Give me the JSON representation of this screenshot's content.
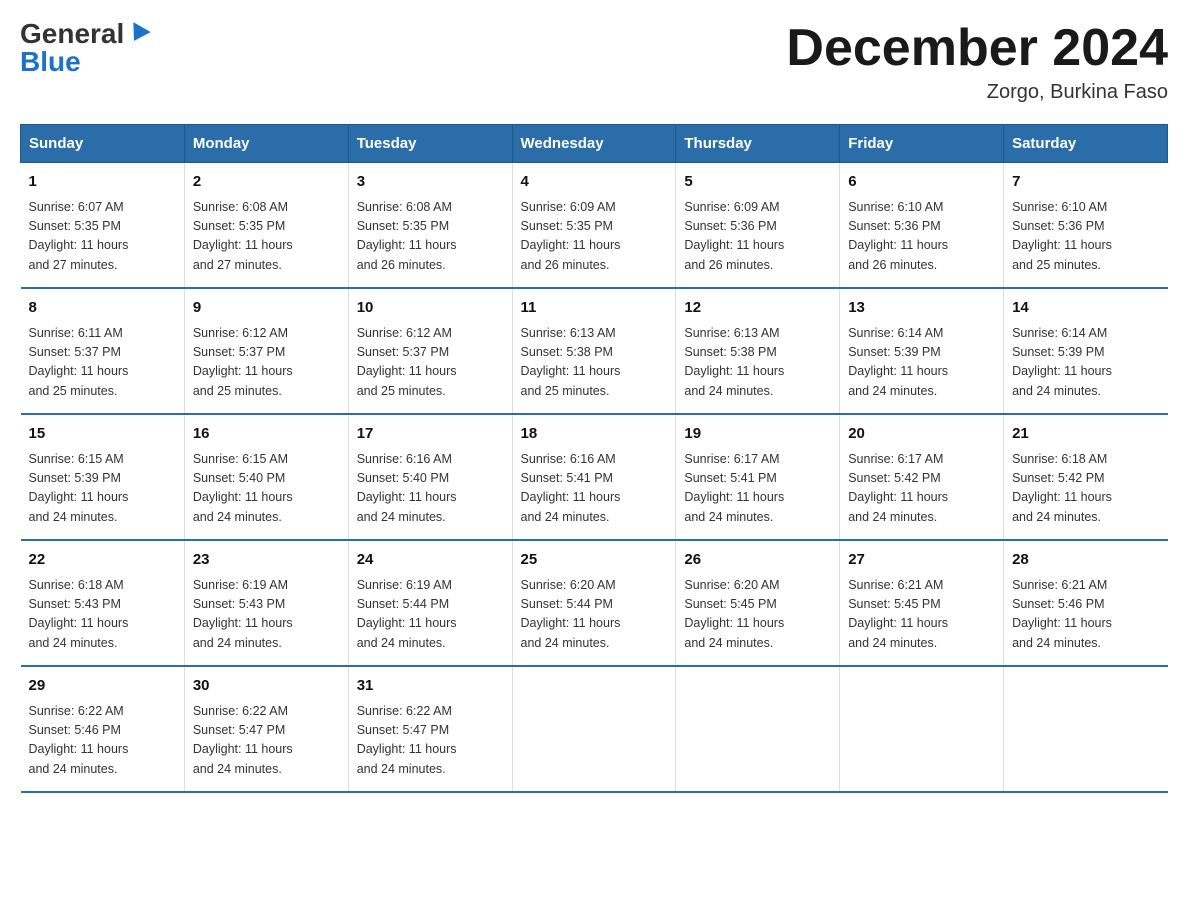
{
  "logo": {
    "general": "General",
    "blue": "Blue"
  },
  "title": "December 2024",
  "location": "Zorgo, Burkina Faso",
  "headers": [
    "Sunday",
    "Monday",
    "Tuesday",
    "Wednesday",
    "Thursday",
    "Friday",
    "Saturday"
  ],
  "weeks": [
    [
      {
        "day": "1",
        "sunrise": "6:07 AM",
        "sunset": "5:35 PM",
        "daylight": "11 hours and 27 minutes."
      },
      {
        "day": "2",
        "sunrise": "6:08 AM",
        "sunset": "5:35 PM",
        "daylight": "11 hours and 27 minutes."
      },
      {
        "day": "3",
        "sunrise": "6:08 AM",
        "sunset": "5:35 PM",
        "daylight": "11 hours and 26 minutes."
      },
      {
        "day": "4",
        "sunrise": "6:09 AM",
        "sunset": "5:35 PM",
        "daylight": "11 hours and 26 minutes."
      },
      {
        "day": "5",
        "sunrise": "6:09 AM",
        "sunset": "5:36 PM",
        "daylight": "11 hours and 26 minutes."
      },
      {
        "day": "6",
        "sunrise": "6:10 AM",
        "sunset": "5:36 PM",
        "daylight": "11 hours and 26 minutes."
      },
      {
        "day": "7",
        "sunrise": "6:10 AM",
        "sunset": "5:36 PM",
        "daylight": "11 hours and 25 minutes."
      }
    ],
    [
      {
        "day": "8",
        "sunrise": "6:11 AM",
        "sunset": "5:37 PM",
        "daylight": "11 hours and 25 minutes."
      },
      {
        "day": "9",
        "sunrise": "6:12 AM",
        "sunset": "5:37 PM",
        "daylight": "11 hours and 25 minutes."
      },
      {
        "day": "10",
        "sunrise": "6:12 AM",
        "sunset": "5:37 PM",
        "daylight": "11 hours and 25 minutes."
      },
      {
        "day": "11",
        "sunrise": "6:13 AM",
        "sunset": "5:38 PM",
        "daylight": "11 hours and 25 minutes."
      },
      {
        "day": "12",
        "sunrise": "6:13 AM",
        "sunset": "5:38 PM",
        "daylight": "11 hours and 24 minutes."
      },
      {
        "day": "13",
        "sunrise": "6:14 AM",
        "sunset": "5:39 PM",
        "daylight": "11 hours and 24 minutes."
      },
      {
        "day": "14",
        "sunrise": "6:14 AM",
        "sunset": "5:39 PM",
        "daylight": "11 hours and 24 minutes."
      }
    ],
    [
      {
        "day": "15",
        "sunrise": "6:15 AM",
        "sunset": "5:39 PM",
        "daylight": "11 hours and 24 minutes."
      },
      {
        "day": "16",
        "sunrise": "6:15 AM",
        "sunset": "5:40 PM",
        "daylight": "11 hours and 24 minutes."
      },
      {
        "day": "17",
        "sunrise": "6:16 AM",
        "sunset": "5:40 PM",
        "daylight": "11 hours and 24 minutes."
      },
      {
        "day": "18",
        "sunrise": "6:16 AM",
        "sunset": "5:41 PM",
        "daylight": "11 hours and 24 minutes."
      },
      {
        "day": "19",
        "sunrise": "6:17 AM",
        "sunset": "5:41 PM",
        "daylight": "11 hours and 24 minutes."
      },
      {
        "day": "20",
        "sunrise": "6:17 AM",
        "sunset": "5:42 PM",
        "daylight": "11 hours and 24 minutes."
      },
      {
        "day": "21",
        "sunrise": "6:18 AM",
        "sunset": "5:42 PM",
        "daylight": "11 hours and 24 minutes."
      }
    ],
    [
      {
        "day": "22",
        "sunrise": "6:18 AM",
        "sunset": "5:43 PM",
        "daylight": "11 hours and 24 minutes."
      },
      {
        "day": "23",
        "sunrise": "6:19 AM",
        "sunset": "5:43 PM",
        "daylight": "11 hours and 24 minutes."
      },
      {
        "day": "24",
        "sunrise": "6:19 AM",
        "sunset": "5:44 PM",
        "daylight": "11 hours and 24 minutes."
      },
      {
        "day": "25",
        "sunrise": "6:20 AM",
        "sunset": "5:44 PM",
        "daylight": "11 hours and 24 minutes."
      },
      {
        "day": "26",
        "sunrise": "6:20 AM",
        "sunset": "5:45 PM",
        "daylight": "11 hours and 24 minutes."
      },
      {
        "day": "27",
        "sunrise": "6:21 AM",
        "sunset": "5:45 PM",
        "daylight": "11 hours and 24 minutes."
      },
      {
        "day": "28",
        "sunrise": "6:21 AM",
        "sunset": "5:46 PM",
        "daylight": "11 hours and 24 minutes."
      }
    ],
    [
      {
        "day": "29",
        "sunrise": "6:22 AM",
        "sunset": "5:46 PM",
        "daylight": "11 hours and 24 minutes."
      },
      {
        "day": "30",
        "sunrise": "6:22 AM",
        "sunset": "5:47 PM",
        "daylight": "11 hours and 24 minutes."
      },
      {
        "day": "31",
        "sunrise": "6:22 AM",
        "sunset": "5:47 PM",
        "daylight": "11 hours and 24 minutes."
      },
      null,
      null,
      null,
      null
    ]
  ],
  "labels": {
    "sunrise": "Sunrise:",
    "sunset": "Sunset:",
    "daylight": "Daylight:"
  }
}
